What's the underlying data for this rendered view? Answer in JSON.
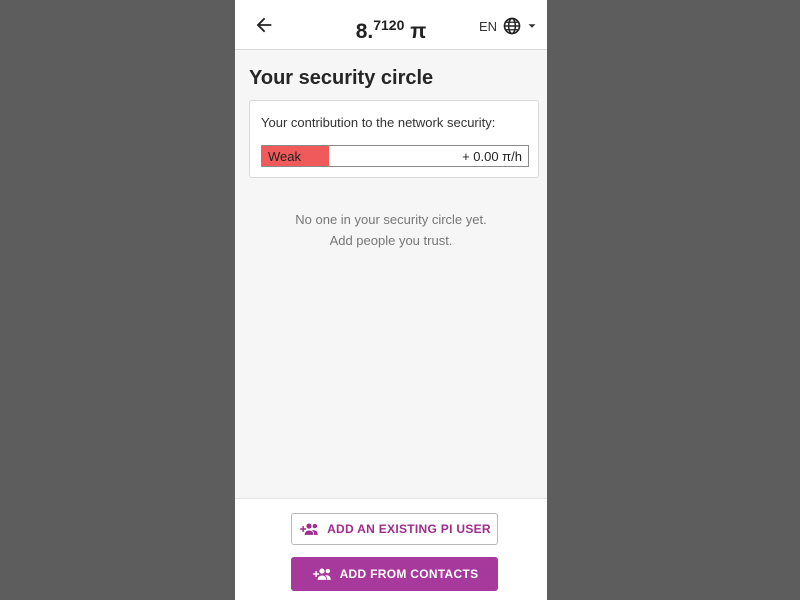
{
  "header": {
    "balance_whole": "8.",
    "balance_fraction": "7120",
    "currency": "π",
    "language": "EN"
  },
  "page": {
    "title": "Your security circle"
  },
  "contribution": {
    "label": "Your contribution to the network security:",
    "level": "Weak",
    "level_fraction": 0.25,
    "level_color": "#f05a5a",
    "rate": "+ 0.00 π/h"
  },
  "empty_state": {
    "line1": "No one in your security circle yet.",
    "line2": "Add people you trust."
  },
  "actions": {
    "add_existing": "ADD AN EXISTING PI USER",
    "add_contacts": "ADD FROM CONTACTS"
  },
  "colors": {
    "accent": "#a8399c",
    "weak": "#f05a5a"
  },
  "icons": {
    "back": "arrow-left-icon",
    "globe": "globe-icon",
    "dropdown": "caret-down-icon",
    "add_people": "add-people-icon"
  }
}
